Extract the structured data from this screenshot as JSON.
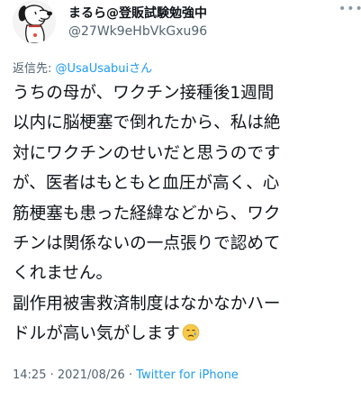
{
  "author": {
    "display_name": "まるら@登販試験勉強中",
    "handle": "@27Wk9eHbVkGxu96",
    "avatar_icon": "snoopy-avatar-icon"
  },
  "more_icon": "more-options-icon",
  "reply": {
    "prefix": "返信先: ",
    "mention": "@UsaUsabui",
    "suffix": "さん"
  },
  "text_lines": [
    "うちの母が、ワクチン接種後1週間",
    "以内に脳梗塞で倒れたから、私は絶",
    "対にワクチンのせいだと思うのです",
    "が、医者はもともと血圧が高く、心",
    "筋梗塞も患った経緯などから、ワク",
    "チンは関係ないの一点張りで認めて",
    "くれません。",
    "副作用被害救済制度はなかなかハー",
    "ドルが高い気がします"
  ],
  "emoji": "crying-face-emoji",
  "meta": {
    "time": "14:25",
    "separator": " · ",
    "date": "2021/08/26",
    "source": "Twitter for iPhone"
  },
  "colors": {
    "text": "#0f1419",
    "secondary": "#536471",
    "link": "#1d9bf0"
  }
}
